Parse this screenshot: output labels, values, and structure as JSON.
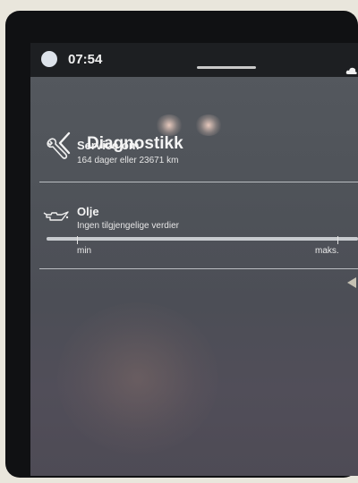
{
  "status": {
    "time": "07:54"
  },
  "header": {
    "title": "Diagnostikk"
  },
  "service": {
    "title": "Service om",
    "detail": "164 dager eller 23671 km"
  },
  "oil": {
    "title": "Olje",
    "detail": "Ingen tilgjengelige verdier",
    "min_label": "min",
    "max_label": "maks."
  },
  "icons": {
    "back": "chevron-left-icon",
    "service": "wrench-icon",
    "oil": "oil-can-icon",
    "status": "cloud-icon"
  },
  "colors": {
    "background": "#4f5359",
    "text": "#f3f3f3",
    "divider": "#b9bcc1"
  }
}
